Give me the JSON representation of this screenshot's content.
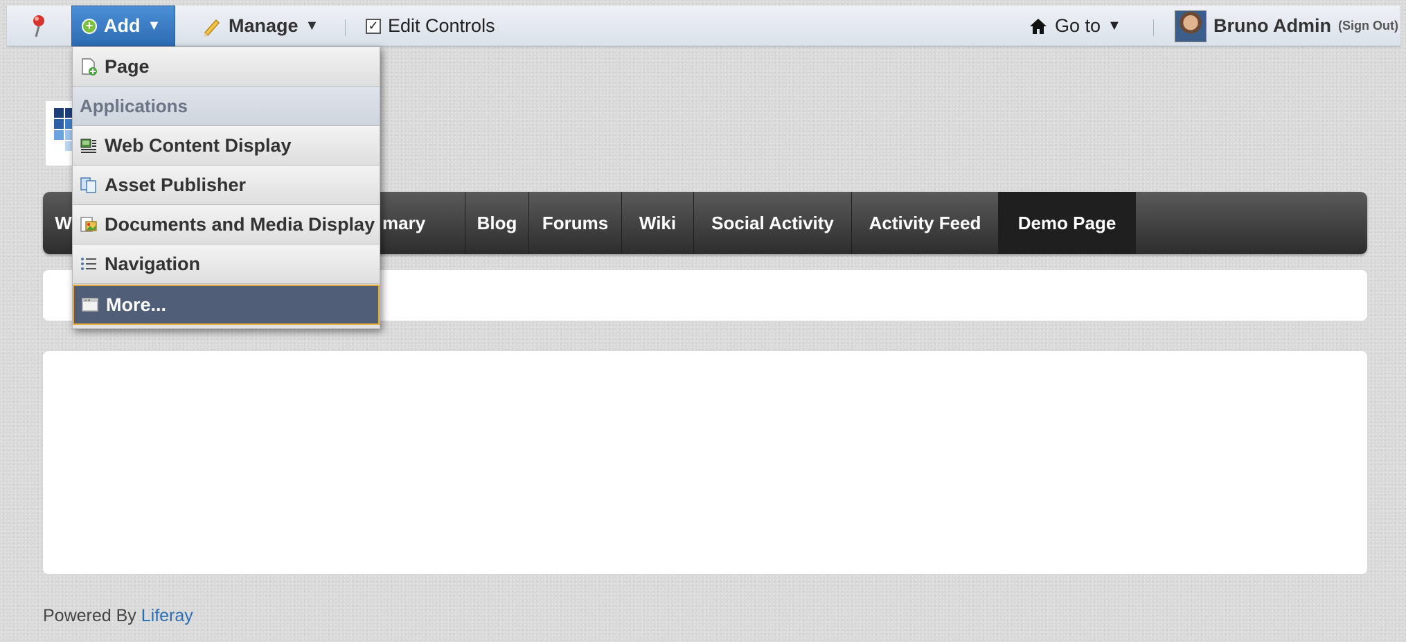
{
  "dockbar": {
    "pin_icon": "pin-icon",
    "add_label": "Add",
    "manage_label": "Manage",
    "edit_controls_label": "Edit Controls",
    "goto_label": "Go to",
    "user_name": "Bruno Admin",
    "sign_out_label": "(Sign Out)",
    "caret": "▼",
    "check_glyph": "✓",
    "home_glyph": "⌂",
    "add_glyph": "+"
  },
  "add_menu": {
    "items": [
      {
        "label": "Page",
        "icon": "page-add-icon"
      },
      {
        "label": "Applications",
        "header": true
      },
      {
        "label": "Web Content Display",
        "icon": "web-content-icon"
      },
      {
        "label": "Asset Publisher",
        "icon": "asset-publisher-icon"
      },
      {
        "label": "Documents and Media Display",
        "icon": "documents-media-icon"
      },
      {
        "label": "Navigation",
        "icon": "navigation-icon"
      },
      {
        "label": "More...",
        "icon": "more-icon",
        "highlighted": true
      }
    ]
  },
  "navigation": {
    "items": [
      {
        "label": "W"
      },
      {
        "label": "mary"
      },
      {
        "label": "Blog"
      },
      {
        "label": "Forums"
      },
      {
        "label": "Wiki"
      },
      {
        "label": "Social Activity"
      },
      {
        "label": "Activity Feed"
      },
      {
        "label": "Demo Page",
        "selected": true
      }
    ]
  },
  "footer": {
    "powered_by": "Powered By",
    "link": "Liferay"
  },
  "colors": {
    "add_button": "#2d6cb2",
    "nav_bar": "#3a3a3a",
    "nav_selected": "#1f1f1f",
    "menu_highlight": "#505e78",
    "menu_highlight_border": "#e0a93a",
    "link": "#2a6fb6"
  }
}
